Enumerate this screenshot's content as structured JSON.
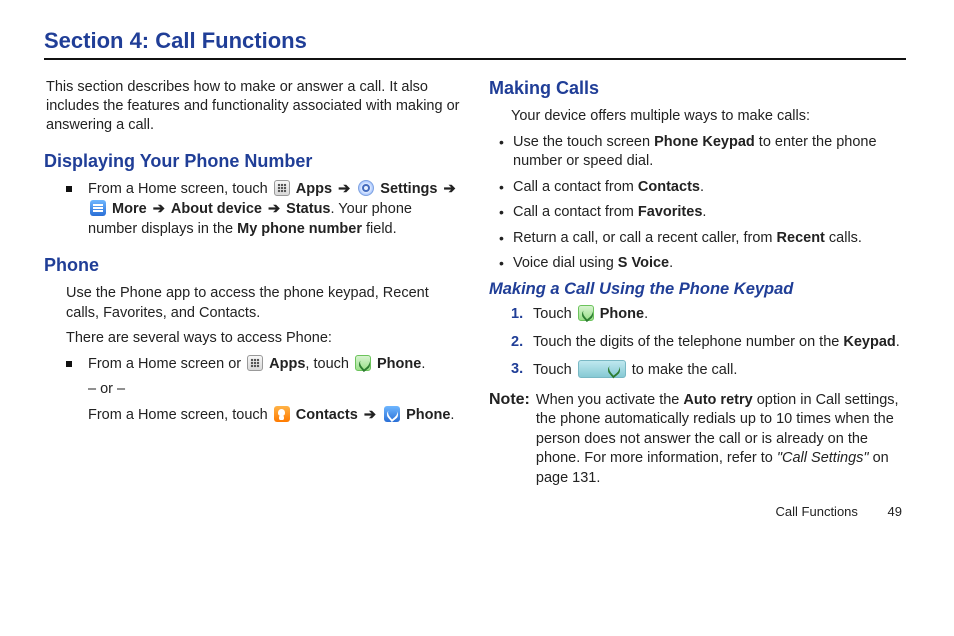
{
  "section_title": "Section 4: Call Functions",
  "intro": "This section describes how to make or answer a call. It also includes the features and functionality associated with making or answering a call.",
  "left": {
    "h_display": "Displaying Your Phone Number",
    "display_steps": {
      "pre1": "From a Home screen, touch ",
      "apps": "Apps",
      "arrow": "➔",
      "settings": "Settings",
      "more": "More",
      "about": "About device",
      "status": "Status",
      "post": ". Your phone number displays in the ",
      "field": "My phone number",
      "tail": " field."
    },
    "h_phone": "Phone",
    "phone_p1": "Use the Phone app to access the phone keypad, Recent calls, Favorites, and Contacts.",
    "phone_p2": "There are several ways to access Phone:",
    "phone_li": {
      "pre1": "From a Home screen or ",
      "apps": "Apps",
      "mid1": ", touch ",
      "phone": "Phone",
      "or": "– or –",
      "pre2": "From a Home screen, touch ",
      "contacts": "Contacts",
      "phone2": "Phone"
    }
  },
  "right": {
    "h_making": "Making Calls",
    "making_p": "Your device offers multiple ways to make calls:",
    "bullets": {
      "b1a": "Use the touch screen ",
      "b1b": "Phone Keypad",
      "b1c": " to enter the phone number or speed dial.",
      "b2a": "Call a contact from ",
      "b2b": "Contacts",
      "b3a": "Call a contact from ",
      "b3b": "Favorites",
      "b4a": "Return a call, or call a recent caller, from ",
      "b4b": "Recent",
      "b4c": " calls.",
      "b5a": "Voice dial using ",
      "b5b": "S Voice"
    },
    "h_sub": "Making a Call Using the Phone Keypad",
    "steps": {
      "s1a": "Touch ",
      "s1b": "Phone",
      "s2a": "Touch the digits of the telephone number on the ",
      "s2b": "Keypad",
      "s3a": "Touch ",
      "s3b": " to make the call."
    },
    "note": {
      "label": "Note:",
      "a": "When you activate the ",
      "b": "Auto retry",
      "c": " option in Call settings, the phone automatically redials up to 10 times when the person does not answer the call or is already on the phone. For more information, refer to ",
      "ref": "\"Call Settings\"",
      "d": " on page 131."
    }
  },
  "footer": {
    "label": "Call Functions",
    "page": "49"
  }
}
